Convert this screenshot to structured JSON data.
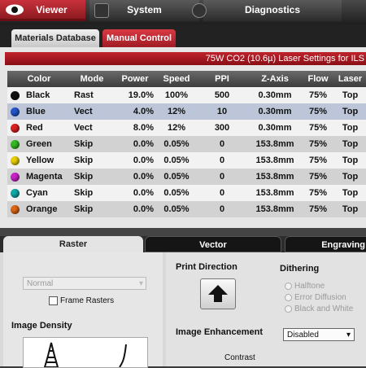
{
  "top_tabs": [
    {
      "label": "Viewer",
      "icon": "eye-icon"
    },
    {
      "label": "System",
      "icon": "system-icon"
    },
    {
      "label": "Diagnostics",
      "icon": "diagnostics-icon"
    }
  ],
  "sub_tabs": [
    "Materials Database",
    "Manual Control"
  ],
  "laser_header": "75W CO2 (10.6µ) Laser Settings for ILS",
  "table": {
    "columns": [
      "Color",
      "Mode",
      "Power",
      "Speed",
      "PPI",
      "Z-Axis",
      "Flow",
      "Laser"
    ],
    "rows": [
      {
        "color": "Black",
        "swatch": "#111111",
        "mode": "Rast",
        "power": "19.0%",
        "speed": "100%",
        "ppi": "500",
        "zaxis": "0.30mm",
        "flow": "75%",
        "laser": "Top"
      },
      {
        "color": "Blue",
        "swatch": "#2255cc",
        "mode": "Vect",
        "power": "4.0%",
        "speed": "12%",
        "ppi": "10",
        "zaxis": "0.30mm",
        "flow": "75%",
        "laser": "Top"
      },
      {
        "color": "Red",
        "swatch": "#dd2222",
        "mode": "Vect",
        "power": "8.0%",
        "speed": "12%",
        "ppi": "300",
        "zaxis": "0.30mm",
        "flow": "75%",
        "laser": "Top"
      },
      {
        "color": "Green",
        "swatch": "#33bb22",
        "mode": "Skip",
        "power": "0.0%",
        "speed": "0.05%",
        "ppi": "0",
        "zaxis": "153.8mm",
        "flow": "75%",
        "laser": "Top"
      },
      {
        "color": "Yellow",
        "swatch": "#e8d000",
        "mode": "Skip",
        "power": "0.0%",
        "speed": "0.05%",
        "ppi": "0",
        "zaxis": "153.8mm",
        "flow": "75%",
        "laser": "Top"
      },
      {
        "color": "Magenta",
        "swatch": "#cc22cc",
        "mode": "Skip",
        "power": "0.0%",
        "speed": "0.05%",
        "ppi": "0",
        "zaxis": "153.8mm",
        "flow": "75%",
        "laser": "Top"
      },
      {
        "color": "Cyan",
        "swatch": "#11aaaa",
        "mode": "Skip",
        "power": "0.0%",
        "speed": "0.05%",
        "ppi": "0",
        "zaxis": "153.8mm",
        "flow": "75%",
        "laser": "Top"
      },
      {
        "color": "Orange",
        "swatch": "#dd6611",
        "mode": "Skip",
        "power": "0.0%",
        "speed": "0.05%",
        "ppi": "0",
        "zaxis": "153.8mm",
        "flow": "75%",
        "laser": "Top"
      }
    ]
  },
  "lower_tabs": [
    "Raster",
    "Vector",
    "Engraving"
  ],
  "raster": {
    "mode_select": "Normal",
    "frame_rasters_label": "Frame Rasters",
    "image_density_label": "Image Density"
  },
  "right": {
    "print_direction_label": "Print Direction",
    "dithering_label": "Dithering",
    "dithering_options": [
      "Halftone",
      "Error Diffusion",
      "Black and White"
    ],
    "image_enhancement_label": "Image Enhancement",
    "image_enhancement_value": "Disabled",
    "contrast_label": "Contrast"
  }
}
